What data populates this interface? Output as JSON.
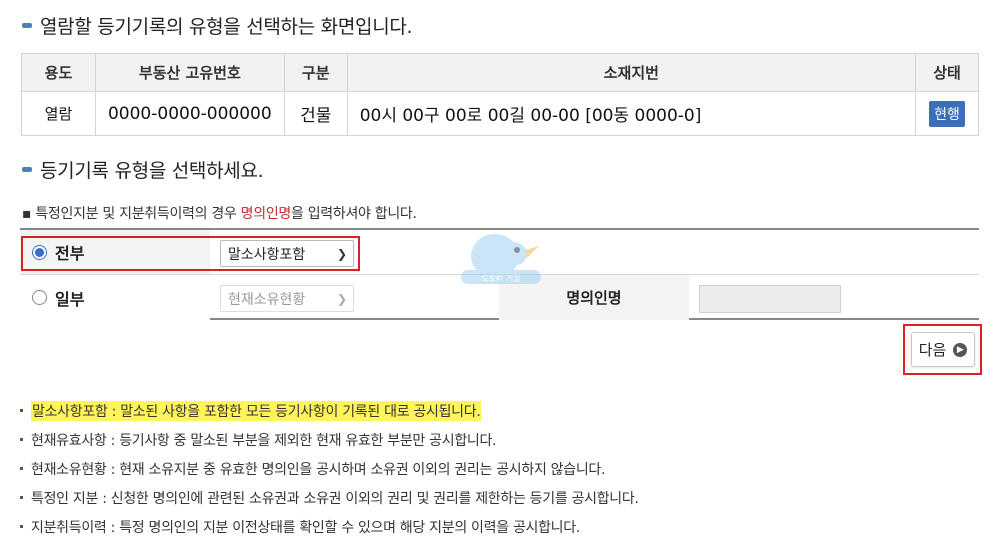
{
  "title1": "열람할 등기기록의 유형을 선택하는 화면입니다.",
  "title2": "등기기록 유형을 선택하세요.",
  "info_table": {
    "headers": [
      "용도",
      "부동산 고유번호",
      "구분",
      "소재지번",
      "상태"
    ],
    "row": {
      "usage": "열람",
      "property_id": "0000-0000-000000",
      "category": "건물",
      "address": "00시 00구 00로 00길 00-00 [00동 0000-0]",
      "status": "현행"
    }
  },
  "note": {
    "before": "특정인지분 및 지분취득이력의 경우 ",
    "highlight": "명의인명",
    "after": "을 입력하셔야 합니다."
  },
  "options": {
    "full": {
      "label": "전부",
      "selected": true,
      "select_value": "말소사항포함"
    },
    "partial": {
      "label": "일부",
      "selected": false,
      "select_value": "현재소유현황"
    },
    "owner_label": "명의인명",
    "owner_value": ""
  },
  "watermark_text": "도토리 겨울",
  "next_button": {
    "label": "다음"
  },
  "descriptions": [
    "말소사항포함 : 말소된 사항을 포함한 모든 등기사항이 기록된 대로 공시됩니다.",
    "현재유효사항 : 등기사항 중 말소된 부분을 제외한 현재 유효한 부분만 공시합니다.",
    "현재소유현황 : 현재 소유지분 중 유효한 명의인을 공시하며 소유권 이외의 권리는 공시하지 않습니다.",
    "특정인 지분 : 신청한 명의인에 관련된 소유권과 소유권 이외의 권리 및 권리를 제한하는 등기를 공시합니다.",
    "지분취득이력 : 특정 명의인의 지분 이전상태를 확인할 수 있으며 해당 지분의 이력을 공시합니다."
  ],
  "colors": {
    "accent": "#3d6fb8",
    "highlight_box": "#e02020",
    "highlight_text_bg": "#fff45a"
  }
}
